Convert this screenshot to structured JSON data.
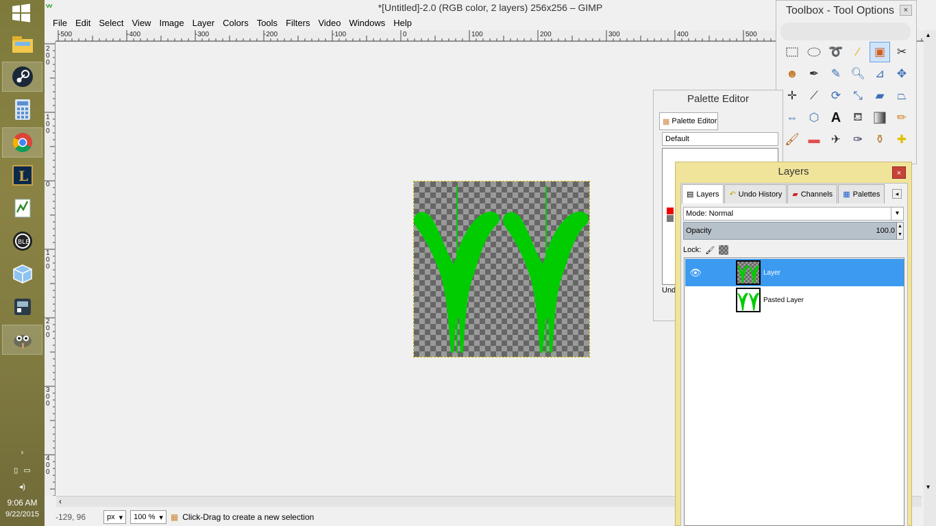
{
  "window": {
    "title": "*[Untitled]-2.0 (RGB color, 2 layers) 256x256 – GIMP"
  },
  "menubar": [
    "File",
    "Edit",
    "Select",
    "View",
    "Image",
    "Layer",
    "Colors",
    "Tools",
    "Filters",
    "Video",
    "Windows",
    "Help"
  ],
  "rulers": {
    "horizontal": [
      "-500",
      "-400",
      "-300",
      "-200",
      "-100",
      "0",
      "100",
      "200",
      "300",
      "400",
      "500"
    ],
    "vertical": [
      "200",
      "100",
      "0",
      "100",
      "200",
      "300",
      "400"
    ]
  },
  "statusbar": {
    "coords": "-129, 96",
    "unit": "px",
    "zoom": "100 %",
    "message": "Click-Drag to create a new selection"
  },
  "taskbar": {
    "time": "9:06 AM",
    "date": "9/22/2015",
    "apps": [
      "file-explorer-icon",
      "steam-icon",
      "calculator-icon",
      "chrome-icon",
      "league-icon",
      "notepad-icon",
      "media-icon",
      "box-icon",
      "app-icon",
      "gimp-icon"
    ]
  },
  "toolbox": {
    "title": "Toolbox - Tool Options",
    "close": "×",
    "tools": [
      "rect-select",
      "ellipse-select",
      "free-select",
      "fuzzy-select",
      "select-by-color",
      "scissors",
      "foreground-select",
      "paths",
      "color-picker",
      "zoom",
      "measure",
      "move",
      "align",
      "crop",
      "rotate",
      "scale",
      "shear",
      "perspective",
      "flip",
      "cage",
      "text",
      "bucket-fill",
      "blend",
      "pencil",
      "paintbrush",
      "eraser",
      "airbrush",
      "ink",
      "clone",
      "heal"
    ],
    "selected_tool": "select-by-color"
  },
  "palette_editor": {
    "title": "Palette Editor",
    "tab": "Palette Editor",
    "palette_name": "Default",
    "undo_label": "Und"
  },
  "layers_panel": {
    "title": "Layers",
    "close": "×",
    "tabs": [
      "Layers",
      "Undo History",
      "Channels",
      "Palettes"
    ],
    "mode_label": "Mode:",
    "mode_value": "Normal",
    "opacity_label": "Opacity",
    "opacity_value": "100.0",
    "lock_label": "Lock:",
    "layers": [
      {
        "name": "Layer",
        "selected": true,
        "visible": true
      },
      {
        "name": "Pasted Layer",
        "selected": false,
        "visible": false
      }
    ]
  },
  "colors": {
    "accent": "#3c9af0",
    "artwork": "#00cc00",
    "layers_frame": "#f0e49a"
  }
}
